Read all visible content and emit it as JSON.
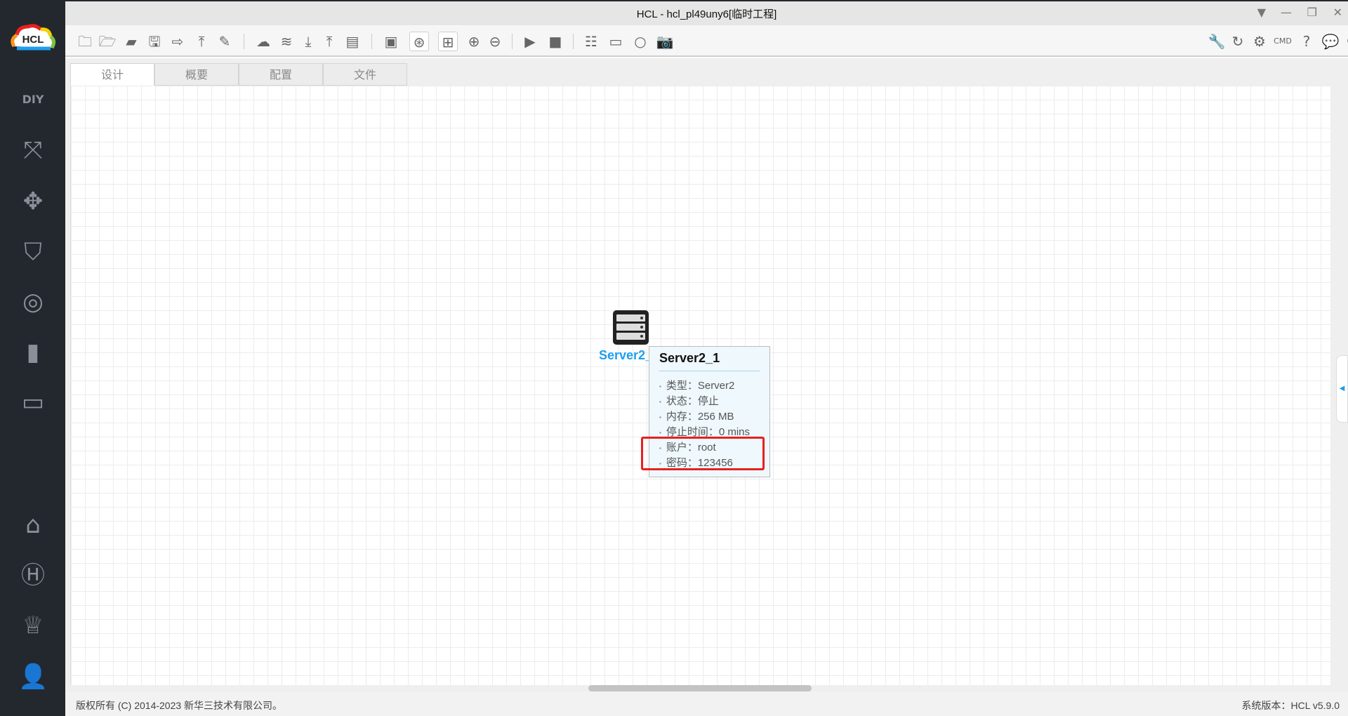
{
  "window": {
    "title": "HCL - hcl_pl49uny6[临时工程]"
  },
  "logo": "HCL",
  "sidebar": {
    "items": [
      "diy",
      "topology",
      "move",
      "security",
      "wireless",
      "server",
      "terminal",
      "home",
      "h3c",
      "trophy",
      "user"
    ]
  },
  "toolbar": {
    "left": [
      "new-project",
      "open-project",
      "open-folder",
      "save",
      "save-as",
      "import",
      "edit",
      "cloud-download",
      "layers",
      "download",
      "upload",
      "log",
      "add-device",
      "topology-view",
      "grid",
      "zoom-in",
      "zoom-out",
      "start",
      "stop",
      "add-list",
      "add-screen",
      "add-circle",
      "snapshot"
    ],
    "right": [
      "wrench",
      "refresh",
      "settings",
      "cmd",
      "help",
      "wechat",
      "feedback"
    ]
  },
  "tabs": [
    "设计",
    "概要",
    "配置",
    "文件"
  ],
  "device": {
    "label": "Server2_1"
  },
  "tooltip": {
    "title": "Server2_1",
    "rows": [
      "类型：Server2",
      "状态：停止",
      "内存：256 MB",
      "停止时间：0 mins",
      "账户：root",
      "密码：123456"
    ]
  },
  "status": {
    "copyright": "版权所有 (C) 2014-2023 新华三技术有限公司。",
    "version": "系统版本：HCL v5.9.0"
  },
  "colors": {
    "accent": "#1e9ef0",
    "highlight": "#e8201e",
    "sidebar": "#23282e"
  }
}
